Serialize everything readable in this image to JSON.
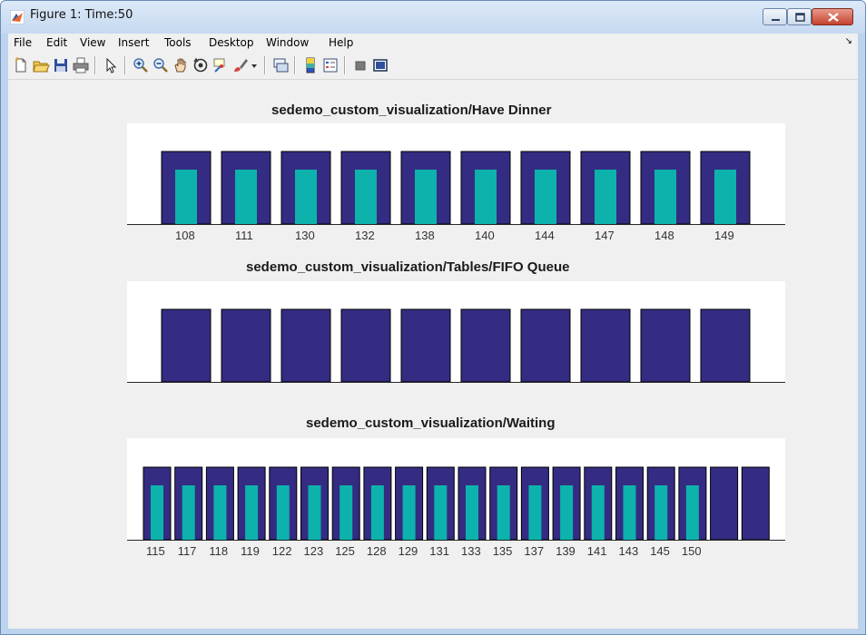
{
  "window": {
    "title": "Figure 1: Time:50"
  },
  "menu": {
    "items": [
      "File",
      "Edit",
      "View",
      "Insert",
      "Tools",
      "Desktop",
      "Window",
      "Help"
    ],
    "overflow_arrow": "↘"
  },
  "toolbar": {
    "icons": [
      "new-figure-icon",
      "open-file-icon",
      "save-icon",
      "print-icon",
      "pointer-icon",
      "zoom-in-icon",
      "zoom-out-icon",
      "pan-icon",
      "rotate-3d-icon",
      "data-cursor-icon",
      "brush-icon",
      "brush-dropdown-icon",
      "link-plot-icon",
      "colorbar-icon",
      "legend-icon",
      "hide-plot-tools-icon",
      "show-plot-tools-icon"
    ]
  },
  "colors": {
    "outer_bar": "#342c82",
    "inner_bar": "#0db2ad",
    "bar_edge": "#000000",
    "axes_bg": "#ffffff",
    "figure_bg": "#f0f0f0"
  },
  "chart_data": [
    {
      "type": "bar",
      "title": "sedemo_custom_visualization/Have Dinner",
      "categories": [
        "108",
        "111",
        "130",
        "132",
        "138",
        "140",
        "144",
        "147",
        "148",
        "149"
      ],
      "series": [
        {
          "values": [
            1,
            1,
            1,
            1,
            1,
            1,
            1,
            1,
            1,
            1
          ]
        },
        {
          "values": [
            0.75,
            0.75,
            0.75,
            0.75,
            0.75,
            0.75,
            0.75,
            0.75,
            0.75,
            0.75
          ]
        }
      ],
      "ylim": [
        0,
        1.2
      ]
    },
    {
      "type": "bar",
      "title": "sedemo_custom_visualization/Tables/FIFO Queue",
      "categories": [
        "",
        "",
        "",
        "",
        "",
        "",
        "",
        "",
        "",
        ""
      ],
      "series": [
        {
          "values": [
            1,
            1,
            1,
            1,
            1,
            1,
            1,
            1,
            1,
            1
          ]
        }
      ],
      "ylim": [
        0,
        1.2
      ]
    },
    {
      "type": "bar",
      "title": "sedemo_custom_visualization/Waiting",
      "categories": [
        "115",
        "117",
        "118",
        "119",
        "122",
        "123",
        "125",
        "128",
        "129",
        "131",
        "133",
        "135",
        "137",
        "139",
        "141",
        "143",
        "145",
        "150",
        "",
        ""
      ],
      "series": [
        {
          "values": [
            1,
            1,
            1,
            1,
            1,
            1,
            1,
            1,
            1,
            1,
            1,
            1,
            1,
            1,
            1,
            1,
            1,
            1,
            1,
            1
          ]
        },
        {
          "values": [
            0.75,
            0.75,
            0.75,
            0.75,
            0.75,
            0.75,
            0.75,
            0.75,
            0.75,
            0.75,
            0.75,
            0.75,
            0.75,
            0.75,
            0.75,
            0.75,
            0.75,
            0.75,
            0,
            0
          ]
        }
      ],
      "ylim": [
        0,
        1.2
      ]
    }
  ]
}
